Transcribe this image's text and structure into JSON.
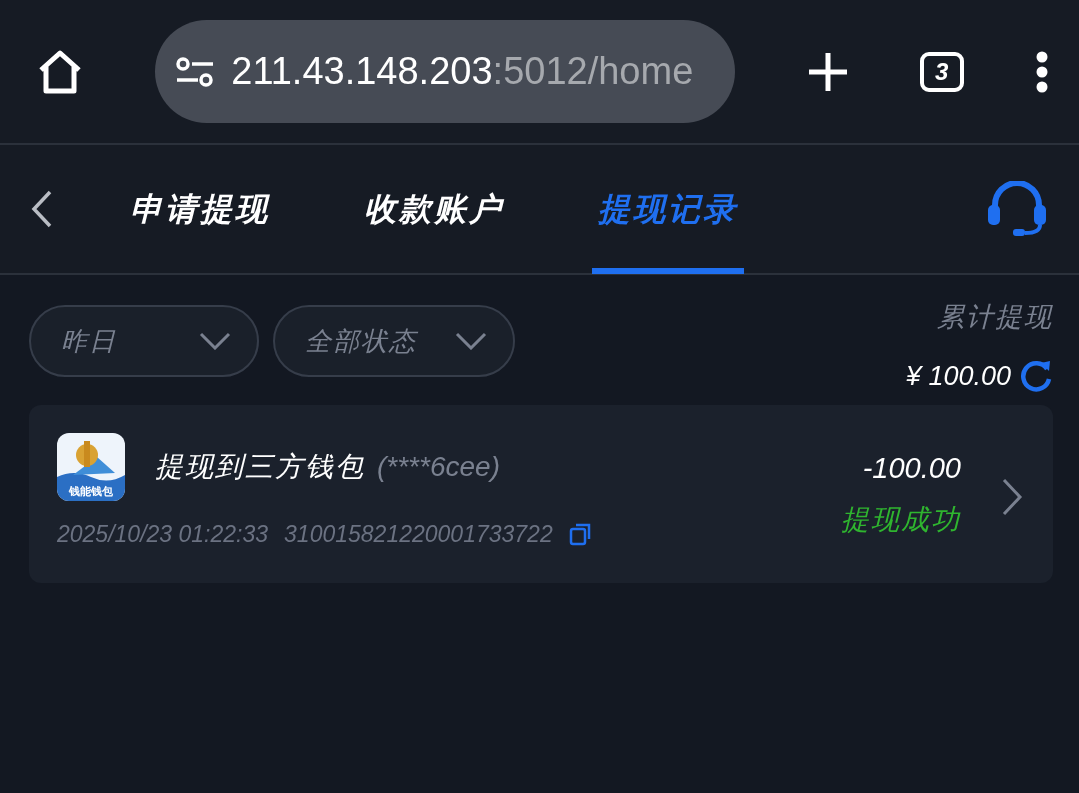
{
  "browser": {
    "url_host": "211.43.148.203",
    "url_path": ":5012/home",
    "tab_count": "3"
  },
  "header": {
    "tabs": [
      {
        "label": "申请提现",
        "selected": false
      },
      {
        "label": "收款账户",
        "selected": false
      },
      {
        "label": "提现记录",
        "selected": true
      }
    ]
  },
  "filters": [
    {
      "label": "昨日"
    },
    {
      "label": "全部状态"
    }
  ],
  "summary": {
    "label": "累计提现",
    "amount": "¥ 100.00"
  },
  "records": [
    {
      "icon_label": "钱能钱包",
      "title": "提现到三方钱包",
      "account": "(****6cee)",
      "time": "2025/10/23 01:22:33",
      "order_no": "310015821220001733722",
      "amount": "-100.00",
      "status": "提现成功",
      "color": "#2fb52f"
    }
  ]
}
